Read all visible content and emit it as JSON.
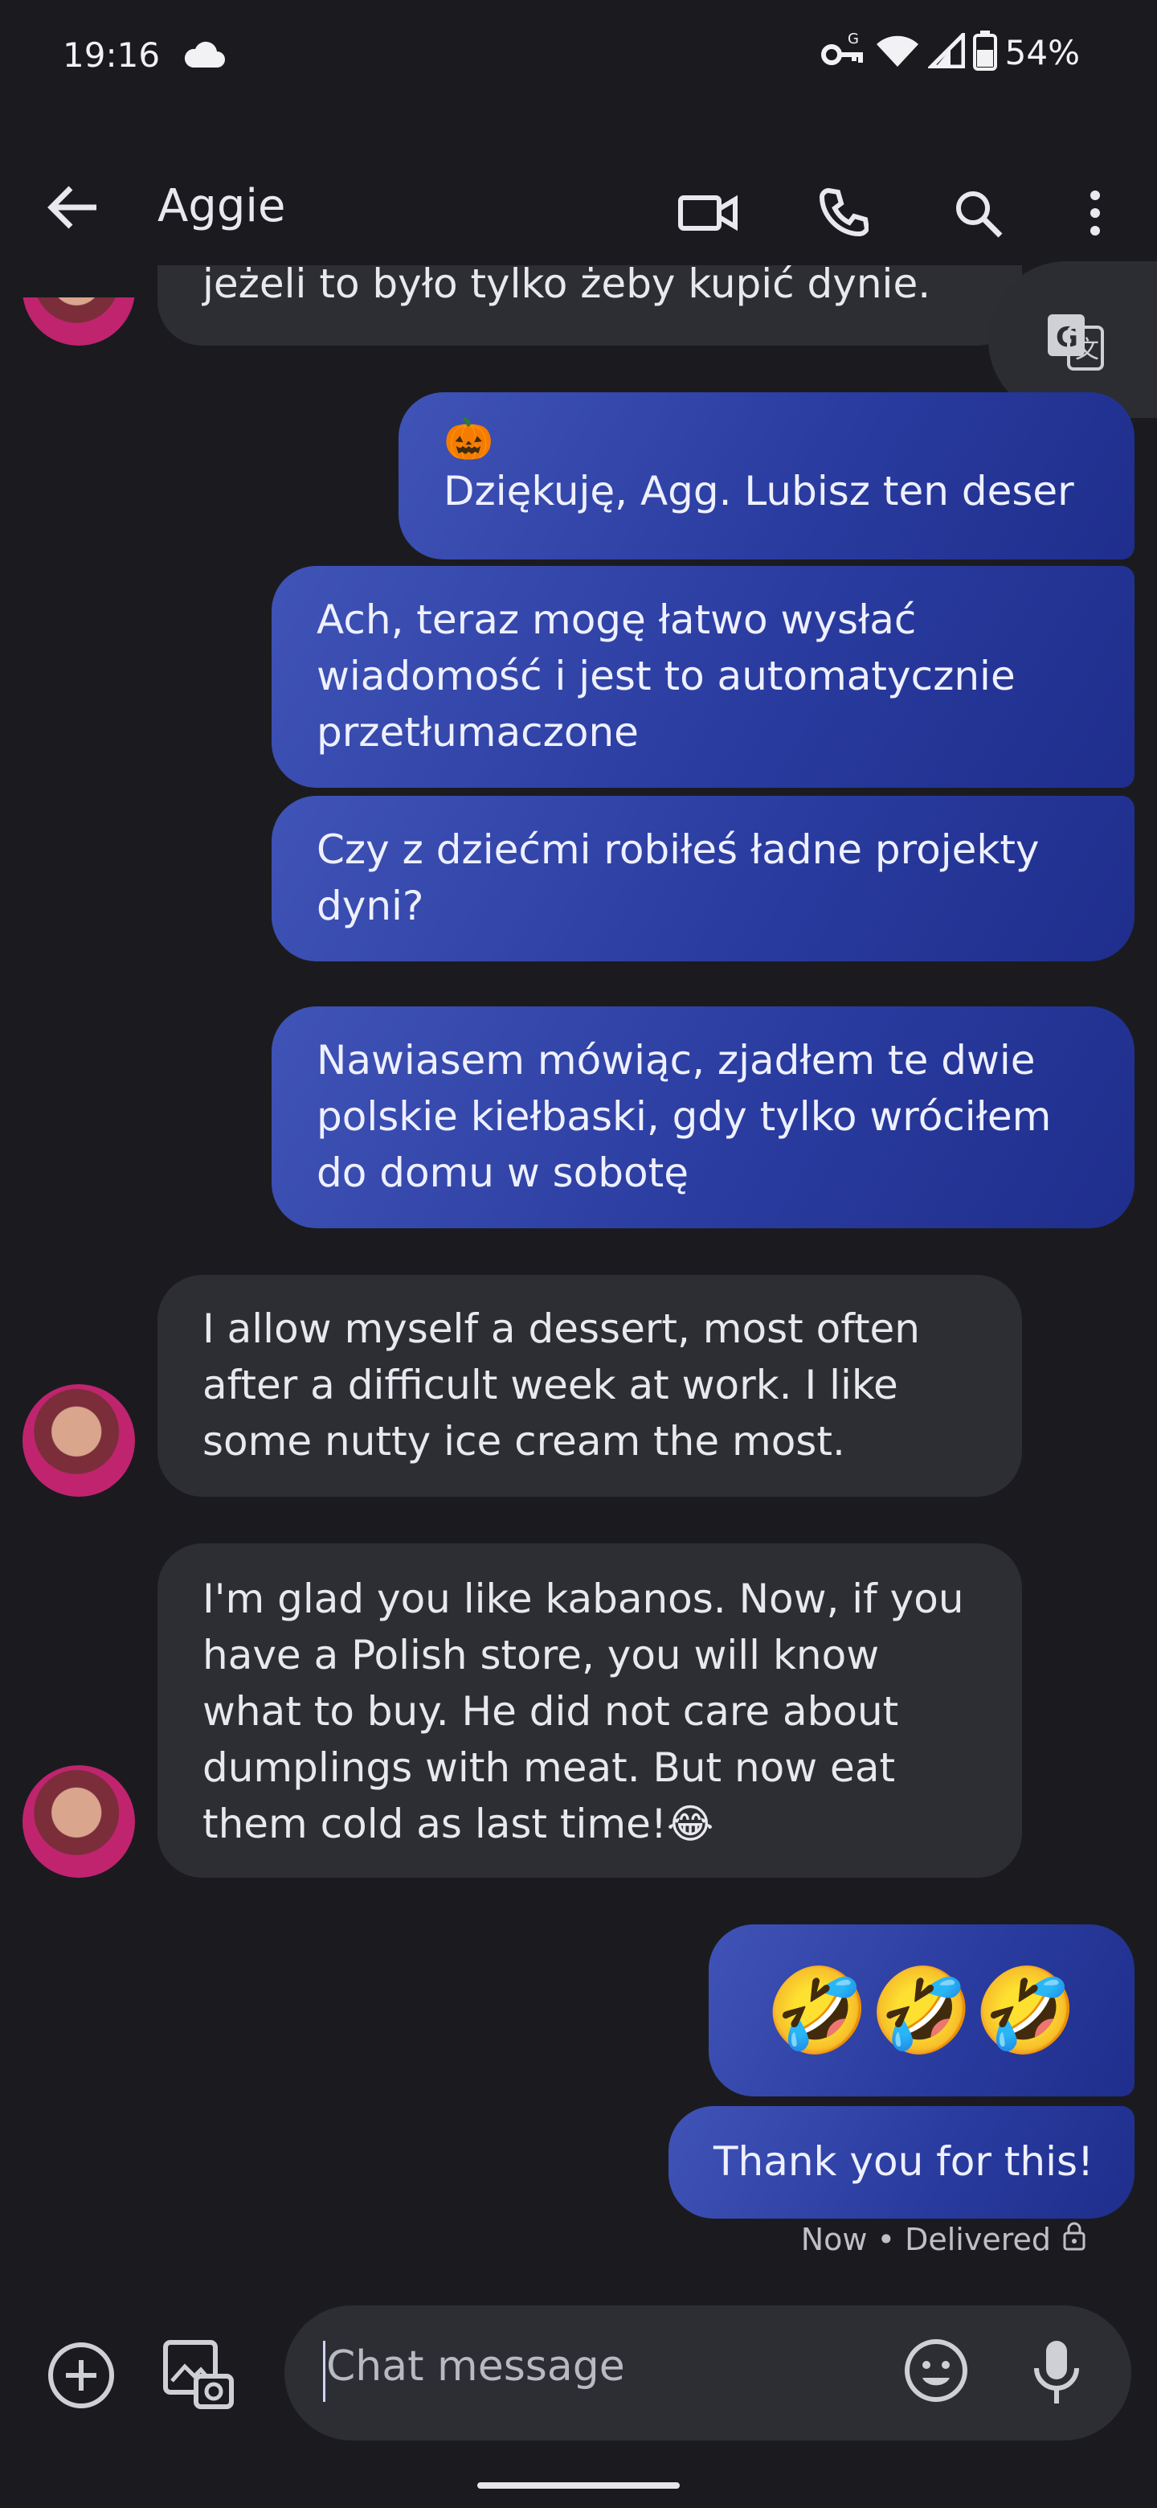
{
  "status_bar": {
    "time": "19:16",
    "battery": "54%"
  },
  "app_bar": {
    "title": "Aggie"
  },
  "messages": [
    {
      "id": "m0",
      "direction": "incoming",
      "text": "jeżeli to było tylko żeby kupić dynie."
    },
    {
      "id": "m1",
      "direction": "outgoing",
      "emoji": "🎃",
      "text": "Dziękuję, Agg.  Lubisz ten deser"
    },
    {
      "id": "m2",
      "direction": "outgoing",
      "text": "Ach, teraz mogę łatwo wysłać wiadomość i jest to automatycznie przetłumaczone"
    },
    {
      "id": "m3",
      "direction": "outgoing",
      "text": "Czy z dziećmi robiłeś ładne projekty dyni?"
    },
    {
      "id": "m4",
      "direction": "outgoing",
      "text": "Nawiasem mówiąc, zjadłem te dwie polskie kiełbaski, gdy tylko wróciłem do domu w sobotę"
    },
    {
      "id": "m5",
      "direction": "incoming",
      "text": "I allow myself a dessert, most often after a difficult week at work. I like some nutty ice cream the most."
    },
    {
      "id": "m6",
      "direction": "incoming",
      "text": "I'm glad you like kabanos. Now, if you have a Polish store, you will know what to buy. He did not care about dumplings with meat. But now eat them cold as last time!😂"
    },
    {
      "id": "m7",
      "direction": "outgoing",
      "text": "🤣🤣🤣"
    },
    {
      "id": "m8",
      "direction": "outgoing",
      "text": "Thank you for this!"
    }
  ],
  "delivery_status": "Now • Delivered",
  "composer": {
    "placeholder": "Chat message"
  },
  "colors": {
    "background": "#1b1b1f",
    "outgoing_bubble": "#2a3ca0",
    "incoming_bubble": "#2d2e34"
  },
  "icons": [
    "back-arrow-icon",
    "video-call-icon",
    "phone-icon",
    "search-icon",
    "more-vert-icon",
    "translate-icon",
    "add-icon",
    "gallery-icon",
    "emoji-icon",
    "mic-icon",
    "lock-icon",
    "cloud-icon",
    "wifi-icon",
    "signal-icon",
    "battery-icon",
    "vpn-key-icon"
  ]
}
